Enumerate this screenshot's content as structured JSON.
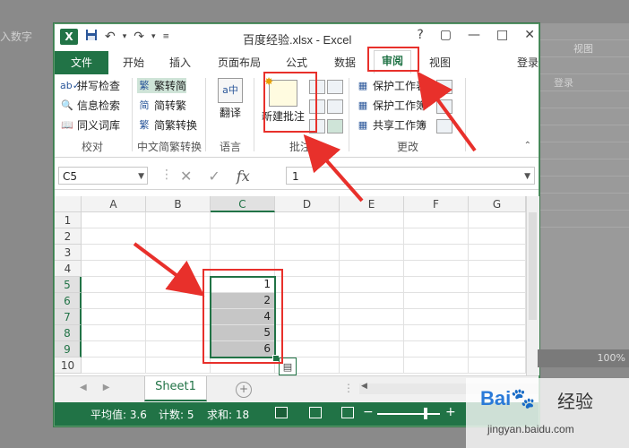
{
  "background": {
    "left_text": "入数字",
    "right_label": "视图",
    "right_label2": "登录",
    "bottom_right": "100%"
  },
  "window": {
    "title": "百度经验.xlsx - Excel",
    "help": "?",
    "controls": {
      "restore": "▢",
      "minimize": "—",
      "maximize": "□",
      "close": "✕"
    }
  },
  "qat": {
    "save_icon": "save-icon",
    "undo": "↶",
    "redo": "↷"
  },
  "tabs": {
    "file": "文件",
    "items": [
      "开始",
      "插入",
      "页面布局",
      "公式",
      "数据",
      "审阅",
      "视图"
    ],
    "active": "审阅",
    "login": "登录"
  },
  "ribbon": {
    "proofing": {
      "spell": "拼写检查",
      "research": "信息检索",
      "thesaurus": "同义词库",
      "label": "校对"
    },
    "chinese": {
      "to_trad": "繁转简",
      "to_simp": "简转繁",
      "convert": "简繁转换",
      "label": "中文简繁转换"
    },
    "language": {
      "translate": "翻译",
      "label": "语言"
    },
    "comments": {
      "new_comment": "新建批注",
      "label": "批注"
    },
    "changes": {
      "protect_sheet": "保护工作表",
      "protect_book": "保护工作簿",
      "share_book": "共享工作簿",
      "label": "更改"
    }
  },
  "formula_bar": {
    "name_box": "C5",
    "value": "1",
    "cancel": "✕",
    "enter": "✓",
    "fx": "fx"
  },
  "grid": {
    "columns": [
      "A",
      "B",
      "C",
      "D",
      "E",
      "F",
      "G"
    ],
    "rows": [
      "1",
      "2",
      "3",
      "4",
      "5",
      "6",
      "7",
      "8",
      "9",
      "10"
    ],
    "selected_column": "C",
    "c_values": {
      "5": "1",
      "6": "2",
      "7": "4",
      "8": "5",
      "9": "6"
    }
  },
  "sheets": {
    "active": "Sheet1",
    "add": "+"
  },
  "status": {
    "average": "平均值: 3.6",
    "count": "计数: 5",
    "sum": "求和: 18",
    "zoom_minus": "−",
    "zoom_plus": "+"
  },
  "watermark": {
    "logo": "Bai",
    "cn": "经验",
    "url": "jingyan.baidu.com"
  },
  "colors": {
    "excel_green": "#217346",
    "annotation_red": "#e8302b"
  }
}
